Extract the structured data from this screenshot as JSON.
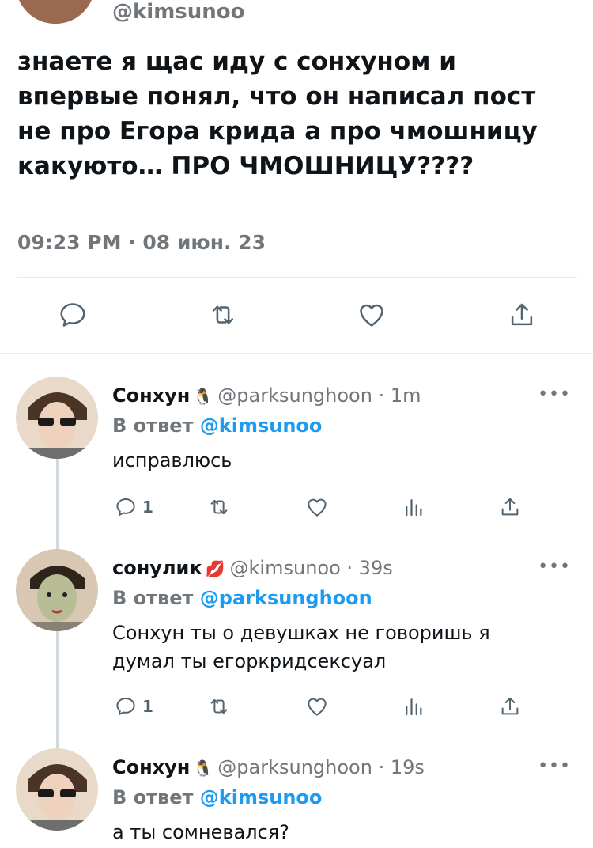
{
  "main_tweet": {
    "handle": "@kimsunoo",
    "text": "знаете я щас иду с сонхуном и впервые понял, что он написал пост не про Егора крида а про чмошницу какуюто… ПРО ЧМОШНИЦУ????",
    "timestamp": "09:23 PM · 08 июн. 23",
    "actions": [
      "reply-icon",
      "retweet-icon",
      "like-icon",
      "share-icon"
    ]
  },
  "replies": [
    {
      "name": "Сонхун",
      "emoji": "🐧",
      "handle": "@parksunghoon",
      "time": "· 1m",
      "reply_prefix": "В ответ",
      "reply_to": "@kimsunoo",
      "text": "исправлюсь",
      "reply_count": "1"
    },
    {
      "name": "сонулик",
      "emoji": "💋",
      "handle": "@kimsunoo",
      "time": "· 39s",
      "reply_prefix": "В ответ",
      "reply_to": "@parksunghoon",
      "text": "Сонхун ты о девушках не говоришь я думал ты егоркридсексуал",
      "reply_count": "1"
    },
    {
      "name": "Сонхун",
      "emoji": "🐧",
      "handle": "@parksunghoon",
      "time": "· 19s",
      "reply_prefix": "В ответ",
      "reply_to": "@kimsunoo",
      "text": "а ты сомневался?",
      "reply_count": ""
    }
  ],
  "more_label": "•••",
  "colors": {
    "accent": "#1d9bf0",
    "secondary_text": "#71767b",
    "icon": "#536471",
    "divider": "#e7e9ea"
  }
}
